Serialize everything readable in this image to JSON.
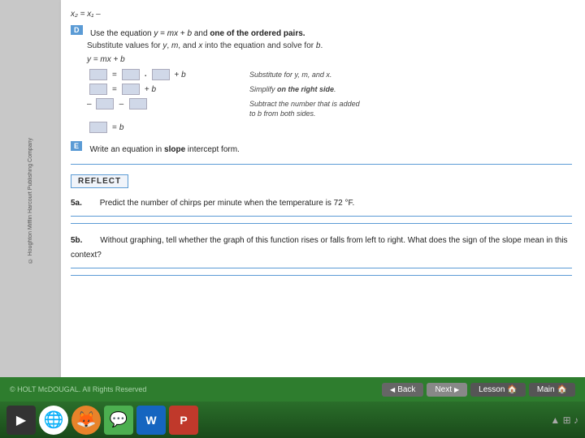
{
  "page": {
    "top_formula": "x₂ = x₁  –",
    "sidebar_text": "© Houghton Mifflin Harcourt Publishing Company",
    "section_d": {
      "label": "D",
      "instruction": "Use the equation y = mx + b and one of the ordered pairs.",
      "sub_instruction": "Substitute values for y, m, and x into the equation and solve for b.",
      "eq_line1": "y = mx + b",
      "eq_note1": "Substitute for y, m, and x.",
      "eq_note2": "Simplify on the right side.",
      "eq_note3": "Subtract the number that is added to b from both sides.",
      "eq_result": "= b"
    },
    "section_e": {
      "label": "E",
      "instruction": "Write an equation in slope intercept form."
    },
    "reflect": {
      "label": "REFLECT",
      "item_5a": {
        "label": "5a.",
        "text": "Predict the number of chirps per minute when the temperature is 72 °F."
      },
      "item_5b": {
        "label": "5b.",
        "text": "Without graphing, tell whether the graph of this function rises or falls from left to right. What does the sign of the slope mean in this context?"
      }
    },
    "footer": {
      "copyright": "© HOLT McDOUGAL. All Rights Reserved",
      "back_btn": "Back",
      "next_btn": "Next",
      "lesson_btn": "Lesson",
      "main_btn": "Main"
    },
    "taskbar": {
      "icons": [
        "▶",
        "⬤",
        "🦊",
        "💬",
        "W",
        "P"
      ]
    }
  }
}
